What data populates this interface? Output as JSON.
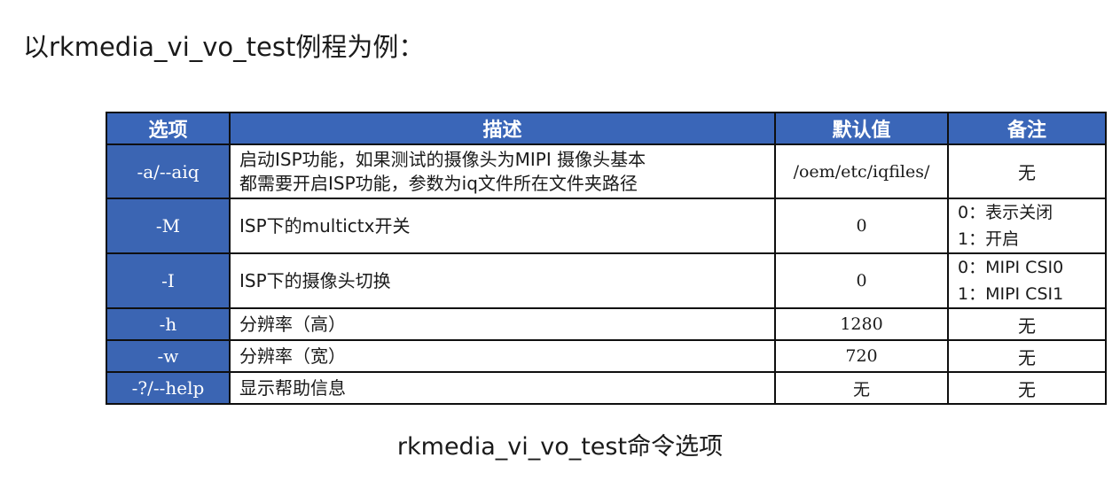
{
  "heading": "以rkmedia_vi_vo_test例程为例：",
  "table": {
    "headers": {
      "option": "选项",
      "description": "描述",
      "default": "默认值",
      "note": "备注"
    },
    "rows": [
      {
        "option": "-a/--aiq",
        "description_lines": [
          "启动ISP功能，如果测试的摄像头为MIPI 摄像头基本",
          "都需要开启ISP功能，参数为iq文件所在文件夹路径"
        ],
        "default": "/oem/etc/iqfiles/",
        "note_lines": [
          "无"
        ]
      },
      {
        "option": "-M",
        "description_lines": [
          "ISP下的multictx开关"
        ],
        "default": "0",
        "note_lines": [
          "0：表示关闭",
          "1：开启"
        ]
      },
      {
        "option": "-I",
        "description_lines": [
          "ISP下的摄像头切换"
        ],
        "default": "0",
        "note_lines": [
          "0：MIPI CSI0",
          "1：MIPI CSI1"
        ]
      },
      {
        "option": "-h",
        "description_lines": [
          "分辨率（高）"
        ],
        "default": "1280",
        "note_lines": [
          "无"
        ]
      },
      {
        "option": "-w",
        "description_lines": [
          "分辨率（宽）"
        ],
        "default": "720",
        "note_lines": [
          "无"
        ]
      },
      {
        "option": "-?/--help",
        "description_lines": [
          "显示帮助信息"
        ],
        "default": "无",
        "note_lines": [
          "无"
        ]
      }
    ]
  },
  "caption": "rkmedia_vi_vo_test命令选项",
  "colors": {
    "header_bg": "#3a66b8",
    "option_bg": "#3b65b3",
    "border": "#0f0f0f",
    "text": "#1a1a1a"
  }
}
